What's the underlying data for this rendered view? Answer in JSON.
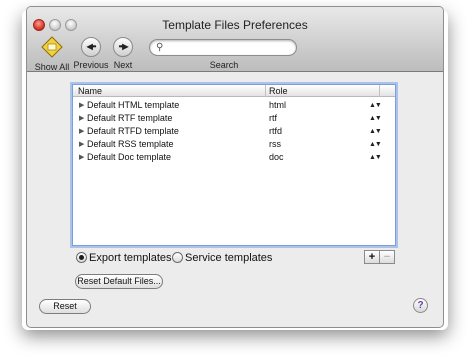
{
  "window": {
    "title": "Template Files Preferences"
  },
  "toolbar": {
    "show_all": "Show All",
    "previous": "Previous",
    "next": "Next",
    "search_label": "Search",
    "search_value": "",
    "search_placeholder": ""
  },
  "table": {
    "headers": {
      "name": "Name",
      "role": "Role"
    },
    "rows": [
      {
        "name": "Default HTML template",
        "role": "html"
      },
      {
        "name": "Default RTF template",
        "role": "rtf"
      },
      {
        "name": "Default RTFD template",
        "role": "rtfd"
      },
      {
        "name": "Default RSS template",
        "role": "rss"
      },
      {
        "name": "Default Doc template",
        "role": "doc"
      }
    ]
  },
  "radios": {
    "export": "Export  templates",
    "service": "Service templates",
    "selected": "export"
  },
  "buttons": {
    "plus": "+",
    "minus": "−",
    "reset_default_files": "Reset Default Files...",
    "reset": "Reset",
    "help": "?"
  },
  "glyphs": {
    "disclosure": "▶",
    "stepper": "▲▼",
    "search": "⚲"
  },
  "colors": {
    "selection_border": "#7e9fd2",
    "focus_ring": "#a9c3ec",
    "close_button": "#d73b2b"
  }
}
